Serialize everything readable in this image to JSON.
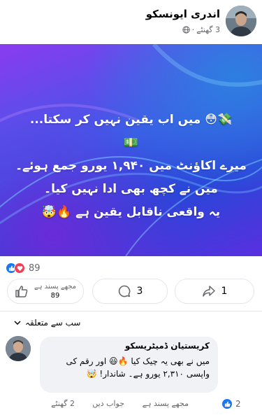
{
  "post": {
    "author": "اندری ایونسکو",
    "time": "3 گھنٹے",
    "lines": [
      "💸😳 میں اب یقین نہیں کر سکتا...",
      "💵",
      "میرے اکاؤنٹ میں ۱,۹۴۰ یورو جمع ہوئے۔",
      "میں نے کچھ بھی ادا نہیں کیا۔",
      "یہ واقعی ناقابل یقین ہے 🔥🤯"
    ]
  },
  "reactions": {
    "count": "89"
  },
  "actions": {
    "like_label": "مجھے پسند ہے",
    "like_count": "89",
    "comment_count": "3",
    "share_count": "1"
  },
  "sort": {
    "label": "سب سے متعلقہ"
  },
  "comment": {
    "author": "کریستیان ڈمیٹریسکو",
    "line1": "میں نے بھی یہ چیک کیا 🔥😃 اور رقم کی",
    "line2": "واپسی ۲,۳۱۰ یورو ہے۔ شاندار! 🤯",
    "time": "2 گھنٹے",
    "reply_label": "جواب دیں",
    "like_label": "مجھے پسند ہے",
    "reaction_count": "2"
  },
  "colors": {
    "accent": "#1877f2",
    "love": "#f33e58",
    "bubble": "#f0f2f5",
    "muted": "#65676b"
  }
}
